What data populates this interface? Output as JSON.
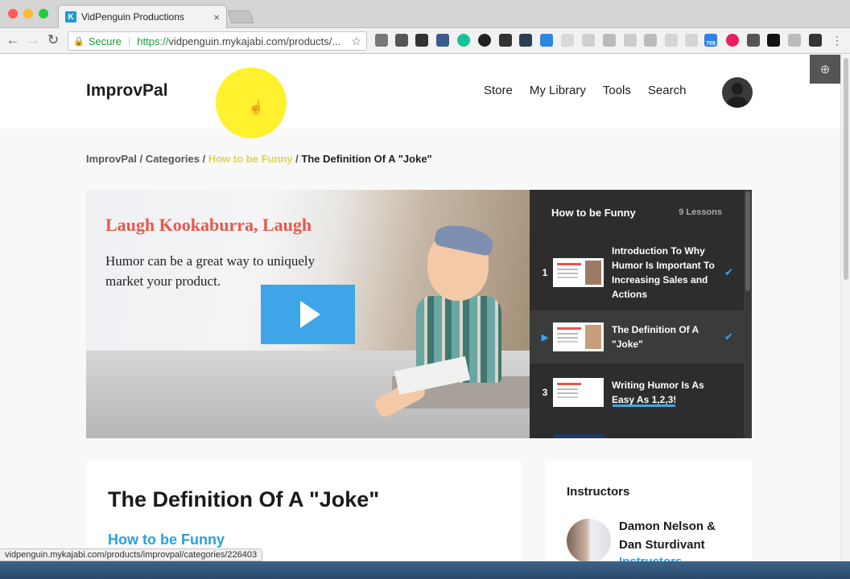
{
  "browser": {
    "tab_title": "VidPenguin Productions",
    "tab_favicon": "K",
    "tab_close": "×",
    "secure_label": "Secure",
    "url_scheme": "https://",
    "url_rest": "vidpenguin.mykajabi.com/products/...",
    "profile_badge": "705",
    "status_url": "vidpenguin.mykajabi.com/products/improvpal/categories/226403"
  },
  "site": {
    "brand": "ImprovPal",
    "nav": [
      "Store",
      "My Library",
      "Tools",
      "Search"
    ]
  },
  "breadcrumb": {
    "items": [
      "ImprovPal",
      "Categories",
      "How to be Funny",
      "The Definition Of A \"Joke\""
    ],
    "sep": "/"
  },
  "video": {
    "title": "Laugh Kookaburra, Laugh",
    "subtitle": "Humor can be a great way to uniquely market your product."
  },
  "playlist": {
    "title": "How to be Funny",
    "count": "9 Lessons",
    "lessons": [
      {
        "num": "1",
        "title": "Introduction To Why Humor Is Important To Increasing Sales and Actions",
        "completed": true
      },
      {
        "num": "▶",
        "title": "The Definition Of A \"Joke\"",
        "completed": true
      },
      {
        "num": "3",
        "title": "Writing Humor Is As Easy As 1,2,3!",
        "completed": false,
        "progress": 0.6
      }
    ]
  },
  "content": {
    "title": "The Definition Of A \"Joke\"",
    "category_link": "How to be Funny"
  },
  "instructors": {
    "heading": "Instructors",
    "name": "Damon Nelson & Dan Sturdivant",
    "role": "Instructors"
  },
  "colors": {
    "accent": "#2aa0dd",
    "video_title": "#e8584b",
    "panel_bg": "#2d2d2d",
    "secure_green": "#1a9c3b"
  }
}
